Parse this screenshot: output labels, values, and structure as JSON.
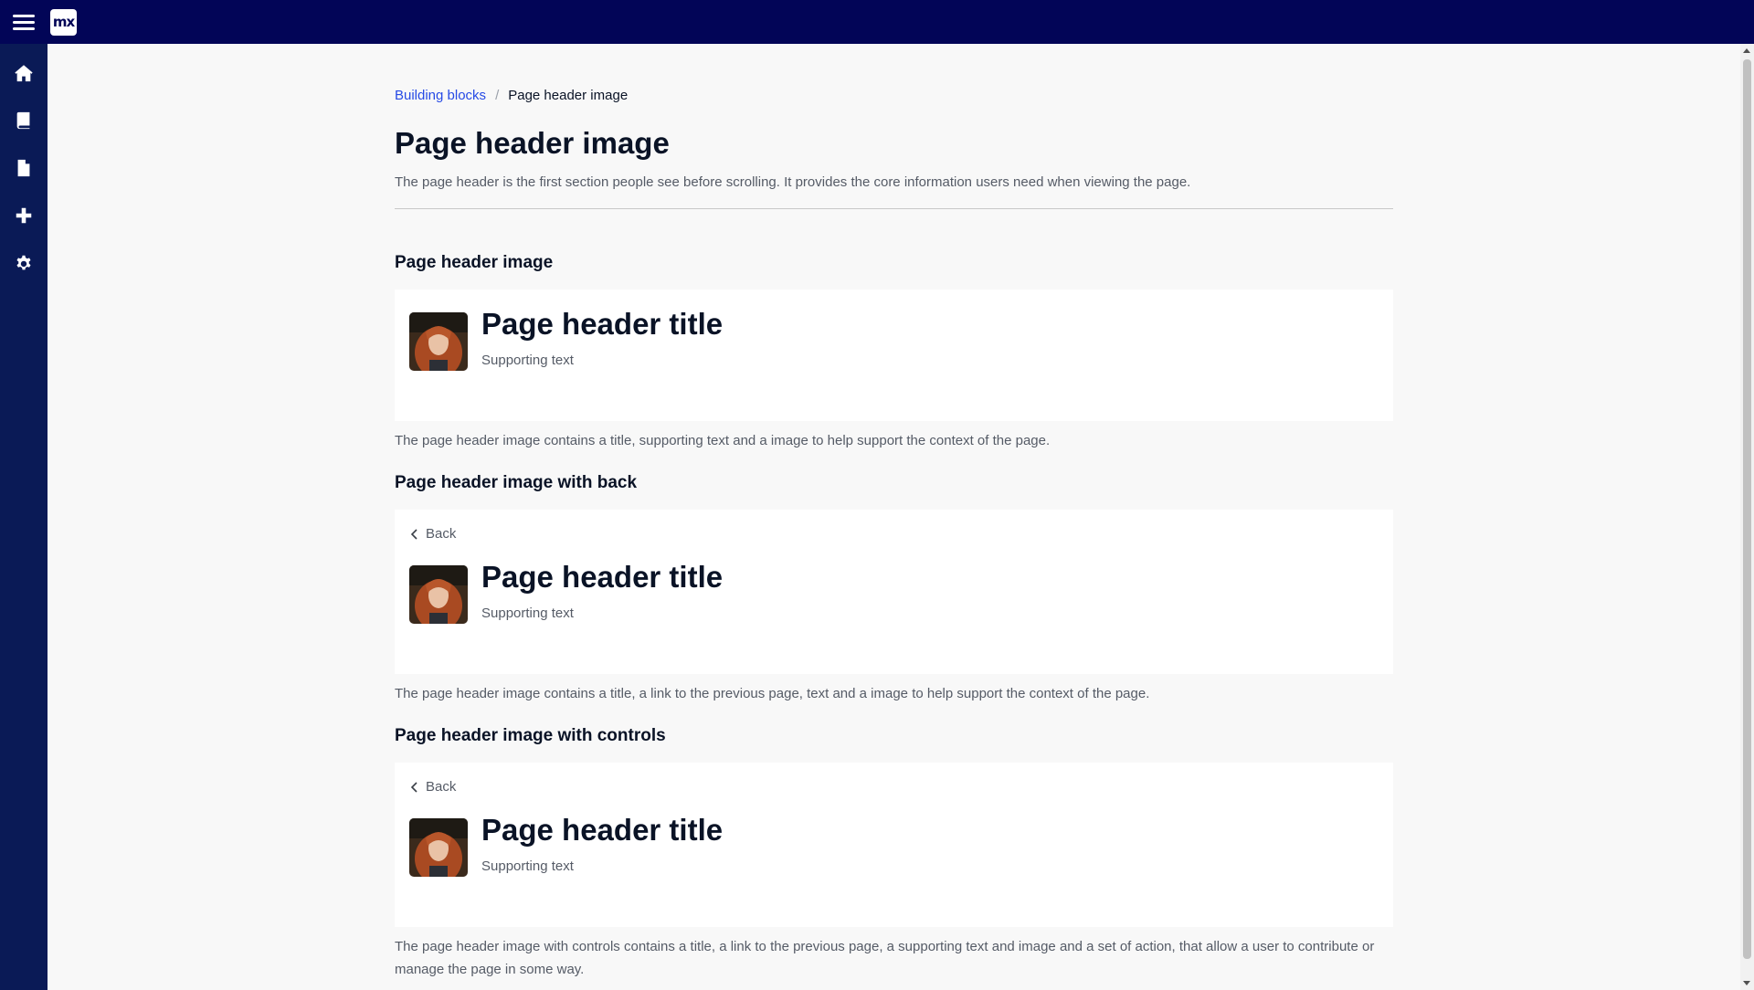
{
  "app": {
    "logo_text": "mx"
  },
  "sidebar": {
    "items": [
      {
        "icon": "home-icon"
      },
      {
        "icon": "book-icon"
      },
      {
        "icon": "document-icon"
      },
      {
        "icon": "plus-icon"
      },
      {
        "icon": "gear-icon"
      }
    ]
  },
  "breadcrumb": {
    "parent": "Building blocks",
    "separator": "/",
    "current": "Page header image"
  },
  "page": {
    "title": "Page header image",
    "description": "The page header is the first section people see before scrolling. It provides the core information users need when viewing the page."
  },
  "sections": [
    {
      "title": "Page header image",
      "header_title": "Page header title",
      "supporting_text": "Supporting text",
      "description": "The page header image contains a title, supporting text and a image to help support the context of the page."
    },
    {
      "title": "Page header image with back",
      "back_label": "Back",
      "header_title": "Page header title",
      "supporting_text": "Supporting text",
      "description": "The page header image contains a title, a link to the previous page, text and a image to help support the context of the page."
    },
    {
      "title": "Page header image with controls",
      "back_label": "Back",
      "header_title": "Page header title",
      "supporting_text": "Supporting text",
      "description": "The page header image with controls contains a title, a link to the previous page, a supporting text and image and a set of action, that allow a user to contribute or manage the page in some way."
    }
  ],
  "colors": {
    "topbar": "#020557",
    "sidebar": "#0a1a56",
    "link": "#264ae5",
    "background": "#f8f8f8"
  }
}
